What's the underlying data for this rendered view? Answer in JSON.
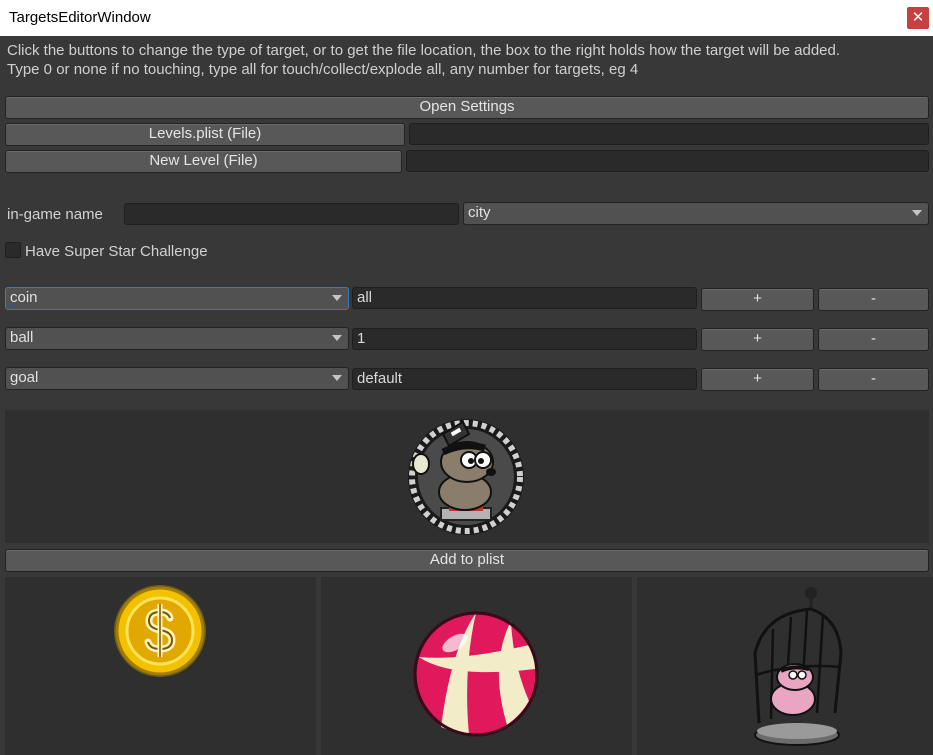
{
  "window": {
    "title": "TargetsEditorWindow",
    "close_glyph": "✕"
  },
  "help_text": {
    "line1": "Click the buttons to change the type of target, or to get the file location, the box to the right holds how the target will be added.",
    "line2": "Type 0 or none if no touching, type all for touch/collect/explode all, any number for targets, eg 4"
  },
  "buttons": {
    "open_settings": "Open Settings",
    "levels_plist": "Levels.plist (File)",
    "new_level": "New Level (File)",
    "add_to_plist": "Add to plist"
  },
  "file_fields": {
    "levels_plist_path": "",
    "new_level_path": ""
  },
  "in_game_name": {
    "label": "in-game name",
    "value": "",
    "theme_selected": "city"
  },
  "super_star": {
    "label": "Have Super Star Challenge",
    "checked": false
  },
  "targets": [
    {
      "type": "coin",
      "value": "all",
      "add_label": "+",
      "remove_label": "-"
    },
    {
      "type": "ball",
      "value": "1",
      "add_label": "+",
      "remove_label": "-"
    },
    {
      "type": "goal",
      "value": "default",
      "add_label": "+",
      "remove_label": "-"
    }
  ],
  "images": {
    "character": "hamster-character-icon",
    "coin": "dollar-coin-icon",
    "ball": "beach-ball-icon",
    "goal": "caged-hamster-icon"
  },
  "colors": {
    "background": "#383838",
    "button": "#585858",
    "field": "#2a2a2a",
    "focus": "#3a79bb",
    "close": "#c94040"
  }
}
